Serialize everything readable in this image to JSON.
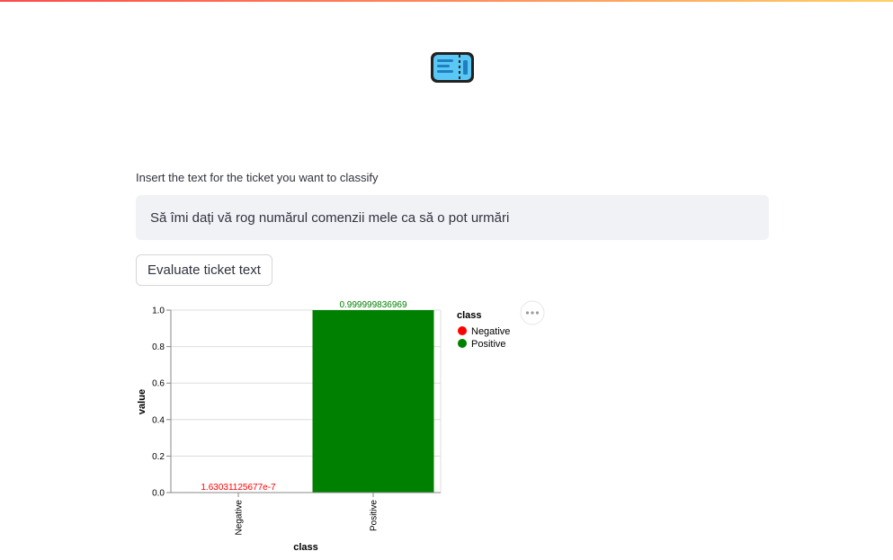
{
  "app": {
    "icon": "ticket-icon"
  },
  "form": {
    "prompt_label": "Insert the text for the ticket you want to classify",
    "input_value": "Să îmi dați vă rog numărul comenzii mele ca să o pot urmări",
    "evaluate_label": "Evaluate ticket text"
  },
  "chart_menu": {
    "icon": "more-horizontal-icon"
  },
  "chart_data": {
    "type": "bar",
    "categories": [
      "Negative",
      "Positive"
    ],
    "values": [
      1.63031125677e-07,
      0.999999836969
    ],
    "value_labels": [
      "1.63031125677e-7",
      "0.999999836969"
    ],
    "colors": [
      "#ff0000",
      "#008000"
    ],
    "xlabel": "class",
    "ylabel": "value",
    "ylim": [
      0,
      1
    ],
    "yticks": [
      "0.0",
      "0.2",
      "0.4",
      "0.6",
      "0.8",
      "1.0"
    ],
    "legend": {
      "title": "class",
      "position": "right",
      "items": [
        "Negative",
        "Positive"
      ]
    },
    "grid": true
  }
}
